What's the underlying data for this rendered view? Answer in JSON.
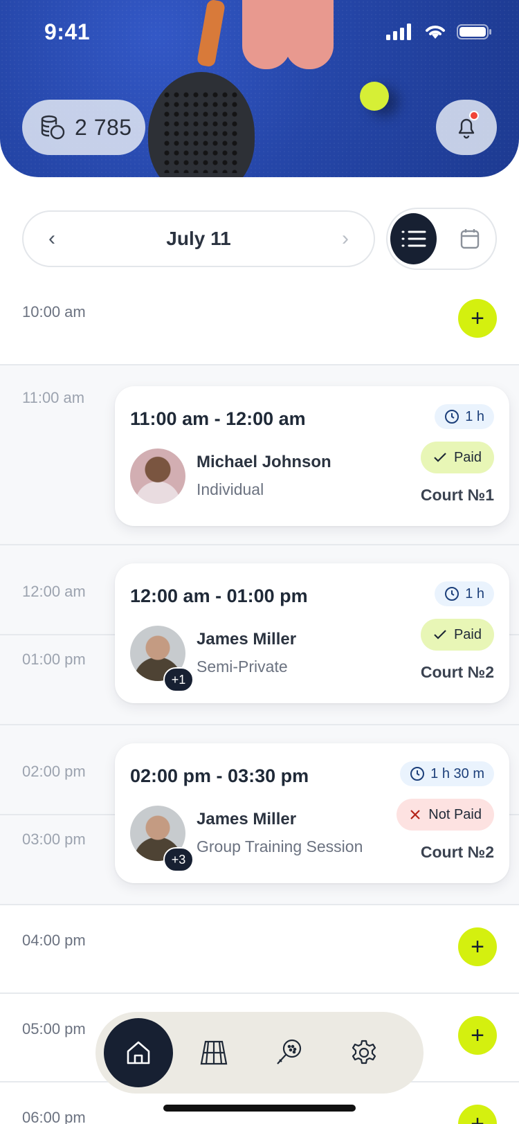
{
  "status_bar": {
    "time": "9:41"
  },
  "header": {
    "coins": "2 785",
    "icons": {
      "coins": "coins-icon",
      "bell": "bell-icon"
    }
  },
  "date_nav": {
    "date": "July 11",
    "prev": "‹",
    "next": "›"
  },
  "view_toggle": {
    "active": "list",
    "options": [
      "list",
      "calendar"
    ]
  },
  "timeline": {
    "slots": [
      "10:00 am",
      "11:00 am",
      "12:00 am",
      "01:00 pm",
      "02:00 pm",
      "03:00 pm",
      "04:00 pm",
      "05:00 pm",
      "06:00 pm"
    ],
    "add_label": "+"
  },
  "bookings": [
    {
      "time": "11:00 am - 12:00 am",
      "duration": "1 h",
      "name": "Michael Johnson",
      "type": "Individual",
      "status": "Paid",
      "court": "Court №1",
      "extra": ""
    },
    {
      "time": "12:00 am - 01:00 pm",
      "duration": "1 h",
      "name": "James Miller",
      "type": "Semi-Private",
      "status": "Paid",
      "court": "Court №2",
      "extra": "+1"
    },
    {
      "time": "02:00 pm - 03:30 pm",
      "duration": "1 h 30 m",
      "name": "James Miller",
      "type": "Group Training Session",
      "status": "Not Paid",
      "court": "Court №2",
      "extra": "+3"
    }
  ],
  "colors": {
    "accent": "#d4f00f",
    "dark": "#172032",
    "paid": "#e8f6b6",
    "unpaid": "#fde2e1"
  },
  "bottom_nav": {
    "active": "home",
    "items": [
      "home-icon",
      "court-icon",
      "racket-icon",
      "settings-icon"
    ]
  }
}
